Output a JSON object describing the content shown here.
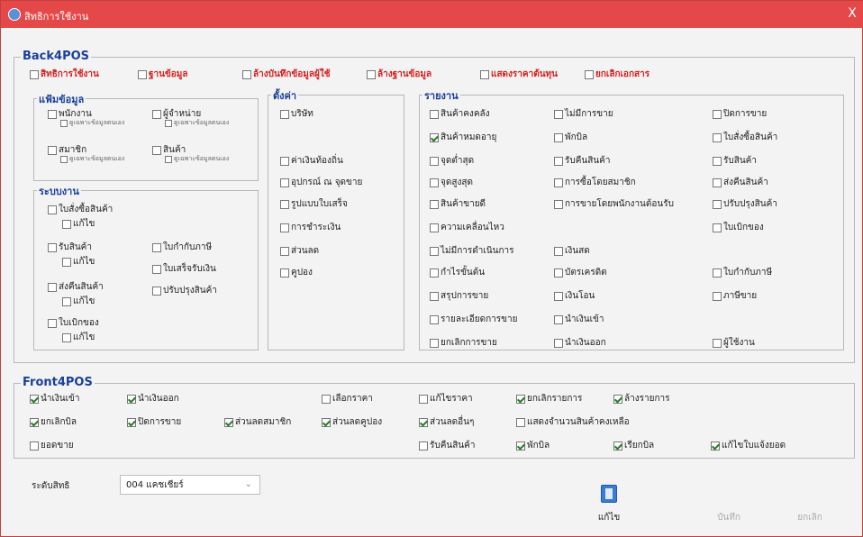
{
  "window": {
    "title": "สิทธิการใช้งาน",
    "close": "X"
  },
  "back4pos": {
    "title": "Back4POS",
    "top": [
      {
        "label": "สิทธิการใช้งาน",
        "checked": false
      },
      {
        "label": "ฐานข้อมูล",
        "checked": false
      },
      {
        "label": "ล้างบันทึกข้อมูลผู้ใช้",
        "checked": false
      },
      {
        "label": "ล้างฐานข้อมูล",
        "checked": false
      },
      {
        "label": "แสดงราคาต้นทุน",
        "checked": false
      },
      {
        "label": "ยกเลิกเอกสาร",
        "checked": false
      }
    ],
    "master": {
      "title": "แฟ้มข้อมูล",
      "items": [
        {
          "label": "พนักงาน",
          "sub": "ดูเฉพาะข้อมูลตนเอง"
        },
        {
          "label": "ผู้จำหน่าย",
          "sub": "ดูเฉพาะข้อมูลตนเอง"
        },
        {
          "label": "สมาชิก",
          "sub": "ดูเฉพาะข้อมูลตนเอง"
        },
        {
          "label": "สินค้า",
          "sub": "ดูเฉพาะข้อมูลตนเอง"
        }
      ]
    },
    "system": {
      "title": "ระบบงาน",
      "items": [
        "ใบสั่งซื้อสินค้า",
        "แก้ไข",
        "รับสินค้า",
        "แก้ไข",
        "ใบกำกับภาษี",
        "ใบเสร็จรับเงิน",
        "ส่งคืนสินค้า",
        "แก้ไข",
        "ปรับปรุงสินค้า",
        "ใบเบิกของ",
        "แก้ไข"
      ]
    },
    "settings": {
      "title": "ตั้งค่า",
      "items": [
        "บริษัท",
        "ค่าเงินท้องถิ่น",
        "อุปกรณ์ ณ จุดขาย",
        "รูปแบบใบเสร็จ",
        "การชำระเงิน",
        "ส่วนลด",
        "คูปอง"
      ]
    },
    "reports": {
      "title": "รายงาน",
      "col1": [
        {
          "label": "สินค้าคงคลัง",
          "checked": false
        },
        {
          "label": "สินค้าหมดอายุ",
          "checked": true
        },
        {
          "label": "จุดต่ำสุด",
          "checked": false
        },
        {
          "label": "จุดสูงสุด",
          "checked": false
        },
        {
          "label": "สินค้าขายดี",
          "checked": false
        },
        {
          "label": "ความเคลื่อนไหว",
          "checked": false
        },
        {
          "label": "ไม่มีการดำเนินการ",
          "checked": false
        },
        {
          "label": "กำไรขั้นต้น",
          "checked": false
        },
        {
          "label": "สรุปการขาย",
          "checked": false
        },
        {
          "label": "รายละเอียดการขาย",
          "checked": false
        },
        {
          "label": "ยกเลิกการขาย",
          "checked": false
        }
      ],
      "col2": [
        {
          "label": "ไม่มีการขาย",
          "checked": false
        },
        {
          "label": "พักบิล",
          "checked": false
        },
        {
          "label": "รับคืนสินค้า",
          "checked": false
        },
        {
          "label": "การซื้อโดยสมาชิก",
          "checked": false
        },
        {
          "label": "การขายโดยพนักงานต้อนรับ",
          "checked": false
        },
        {
          "label": "เงินสด",
          "checked": false
        },
        {
          "label": "บัตรเครดิต",
          "checked": false
        },
        {
          "label": "เงินโอน",
          "checked": false
        },
        {
          "label": "นำเงินเข้า",
          "checked": false
        },
        {
          "label": "นำเงินออก",
          "checked": false
        }
      ],
      "col3": [
        {
          "label": "ปิดการขาย",
          "checked": false
        },
        {
          "label": "ใบสั่งซื้อสินค้า",
          "checked": false
        },
        {
          "label": "รับสินค้า",
          "checked": false
        },
        {
          "label": "ส่งคืนสินค้า",
          "checked": false
        },
        {
          "label": "ปรับปรุงสินค้า",
          "checked": false
        },
        {
          "label": "ใบเบิกของ",
          "checked": false
        },
        {
          "label": "ใบกำกับภาษี",
          "checked": false
        },
        {
          "label": "ภาษีขาย",
          "checked": false
        },
        {
          "label": "ผู้ใช้งาน",
          "checked": false
        }
      ]
    }
  },
  "front4pos": {
    "title": "Front4POS",
    "row1": [
      {
        "label": "นำเงินเข้า",
        "checked": true
      },
      {
        "label": "นำเงินออก",
        "checked": true
      },
      {
        "label": "เลือกราคา",
        "checked": false
      },
      {
        "label": "แก้ไขราคา",
        "checked": false
      },
      {
        "label": "ยกเลิกรายการ",
        "checked": true
      },
      {
        "label": "ล้างรายการ",
        "checked": true
      }
    ],
    "row2": [
      {
        "label": "ยกเลิกบิล",
        "checked": true
      },
      {
        "label": "ปิดการขาย",
        "checked": true
      },
      {
        "label": "ส่วนลดสมาชิก",
        "checked": true
      },
      {
        "label": "ส่วนลดคูปอง",
        "checked": true
      },
      {
        "label": "ส่วนลดอื่นๆ",
        "checked": true
      },
      {
        "label": "แสดงจำนวนสินค้าคงเหลือ",
        "checked": false
      }
    ],
    "row3": [
      {
        "label": "ยอดขาย",
        "checked": false
      },
      {
        "label": "รับคืนสินค้า",
        "checked": false
      },
      {
        "label": "พักบิล",
        "checked": true
      },
      {
        "label": "เรียกบิล",
        "checked": true
      },
      {
        "label": "แก้ไขใบแจ้งยอด",
        "checked": true
      }
    ]
  },
  "bottom": {
    "level_label": "ระดับสิทธิ",
    "level_value": "004 แคชเชียร์",
    "edit_label": "แก้ไข",
    "save_label": "บันทึก",
    "cancel_label": "ยกเลิก"
  }
}
